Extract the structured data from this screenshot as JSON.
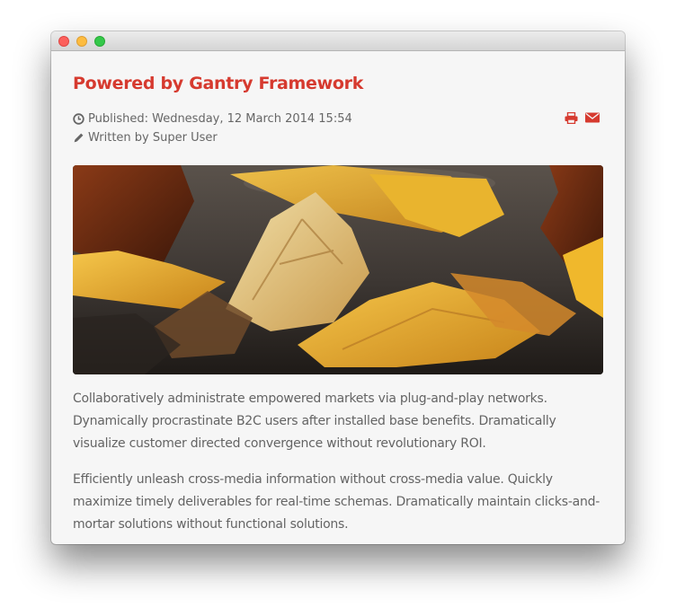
{
  "window": {
    "buttons": [
      "close",
      "minimize",
      "zoom"
    ]
  },
  "article": {
    "title": "Powered by Gantry Framework",
    "published": "Published: Wednesday, 12 March 2014 15:54",
    "author": "Written by Super User",
    "icons": {
      "published": "clock-icon",
      "author": "pencil-icon",
      "print": "print-icon",
      "email": "envelope-icon"
    },
    "image": "autumn-leaves-photo",
    "paragraphs": [
      "Collaboratively administrate empowered markets via plug-and-play networks. Dynamically procrastinate B2C users after installed base benefits. Dramatically visualize customer directed convergence without revolutionary ROI.",
      "Efficiently unleash cross-media information without cross-media value. Quickly maximize timely deliverables for real-time schemas. Dramatically maintain clicks-and-mortar solutions without functional solutions."
    ]
  },
  "colors": {
    "accent": "#d63a2f",
    "body_text": "#646464",
    "meta_text": "#666666",
    "background": "#f6f6f6"
  }
}
